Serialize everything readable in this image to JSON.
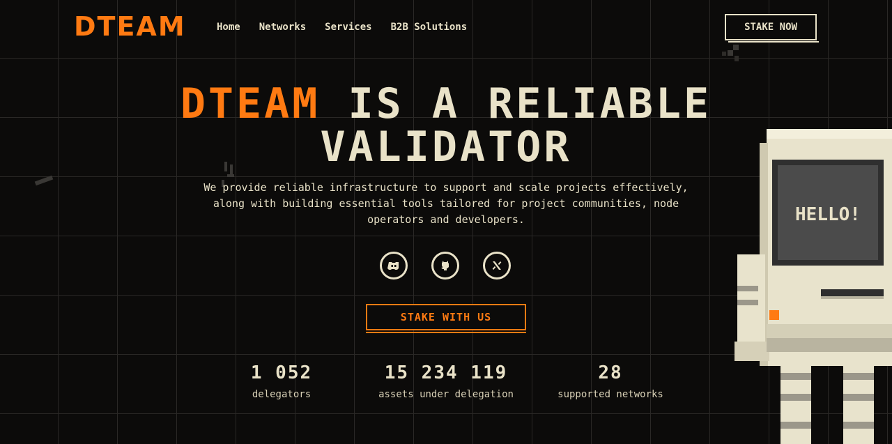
{
  "header": {
    "logo": "DTEAM",
    "nav": [
      "Home",
      "Networks",
      "Services",
      "B2B Solutions"
    ],
    "stake_now": "STAKE NOW"
  },
  "hero": {
    "title_accent": "DTEAM",
    "title_rest": "IS A RELIABLE",
    "title_line2": "VALIDATOR",
    "description": "We provide reliable infrastructure to support and scale projects effectively, along with building essential tools tailored for project communities, node operators and developers.",
    "socials": [
      "discord-icon",
      "github-icon",
      "x-icon"
    ],
    "cta": "STAKE WITH US"
  },
  "stats": [
    {
      "value": "1 052",
      "label": "delegators"
    },
    {
      "value": "15 234 119",
      "label": "assets under delegation"
    },
    {
      "value": "28",
      "label": "supported networks"
    }
  ],
  "robot": {
    "screen_text": "HELLO!"
  },
  "colors": {
    "accent": "#ff7a12",
    "cream": "#e9e2c8",
    "background": "#0c0b0a"
  }
}
